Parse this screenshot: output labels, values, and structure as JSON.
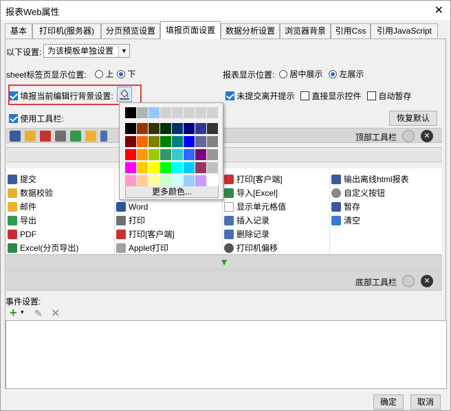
{
  "window": {
    "title": "报表Web属性",
    "close": "✕"
  },
  "tabs": [
    {
      "label": "基本"
    },
    {
      "label": "打印机(服务器)"
    },
    {
      "label": "分页预览设置"
    },
    {
      "label": "填报页面设置"
    },
    {
      "label": "数据分析设置"
    },
    {
      "label": "浏览器背景"
    },
    {
      "label": "引用Css"
    },
    {
      "label": "引用JavaScript"
    }
  ],
  "settings": {
    "scope_label": "以下设置:",
    "scope_value": "为该模板单独设置",
    "sheet_pos_label": "sheet标签页显示位置:",
    "sheet_top": "上",
    "sheet_bottom": "下",
    "report_pos_label": "报表显示位置:",
    "report_center": "居中展示",
    "report_left": "左展示",
    "fill_bg_label": "填报当前编辑行背景设置:",
    "unsubmitted_label": "未提交离开提示",
    "direct_ctrl_label": "直接显示控件",
    "autosave_label": "自动暂存",
    "toolbar_label": "使用工具栏:",
    "restore_default": "恢复默认",
    "top_toolbar": "顶部工具栏",
    "bottom_toolbar": "底部工具栏"
  },
  "palette": {
    "more_colors": "更多颜色...",
    "rows": [
      [
        "#000000",
        "#b4b4b4",
        "#96c8ff",
        "#d2d2d2",
        "#d2d2d2",
        "#d2d2d2",
        "#d2d2d2",
        "#d2d2d2"
      ],
      [
        "#000000",
        "#993300",
        "#333300",
        "#003300",
        "#003366",
        "#000080",
        "#333399",
        "#333333"
      ],
      [
        "#800000",
        "#ff6600",
        "#808000",
        "#008000",
        "#008080",
        "#0000ff",
        "#666699",
        "#808080"
      ],
      [
        "#ff0000",
        "#ff9900",
        "#99cc00",
        "#339966",
        "#33cccc",
        "#3366ff",
        "#800080",
        "#969696"
      ],
      [
        "#ff00ff",
        "#ffcc00",
        "#ffff00",
        "#00ff00",
        "#00ffff",
        "#00ccff",
        "#993366",
        "#c0c0c0"
      ],
      [
        "#ff99cc",
        "#ffcc99",
        "#ffff99",
        "#ccffcc",
        "#ccffff",
        "#99ccff",
        "#cc99ff",
        "#ffffff"
      ]
    ]
  },
  "grid": {
    "col1": [
      "提交",
      "数据校验",
      "邮件",
      "导出",
      "PDF",
      "Excel(分页导出)"
    ],
    "col2": [
      "",
      "",
      "Word",
      "打印",
      "打印[客户端]",
      "Applet打印"
    ],
    "col3": [
      "打印[客户端]",
      "导入[Excel]",
      "显示单元格值",
      "插入记录",
      "删除记录",
      "打印机偏移"
    ],
    "col4": [
      "输出离线html报表",
      "自定义按钮",
      "暂存",
      "清空",
      "",
      ""
    ]
  },
  "events": {
    "label": "事件设置:"
  },
  "footer": {
    "ok": "确定",
    "cancel": "取消"
  }
}
